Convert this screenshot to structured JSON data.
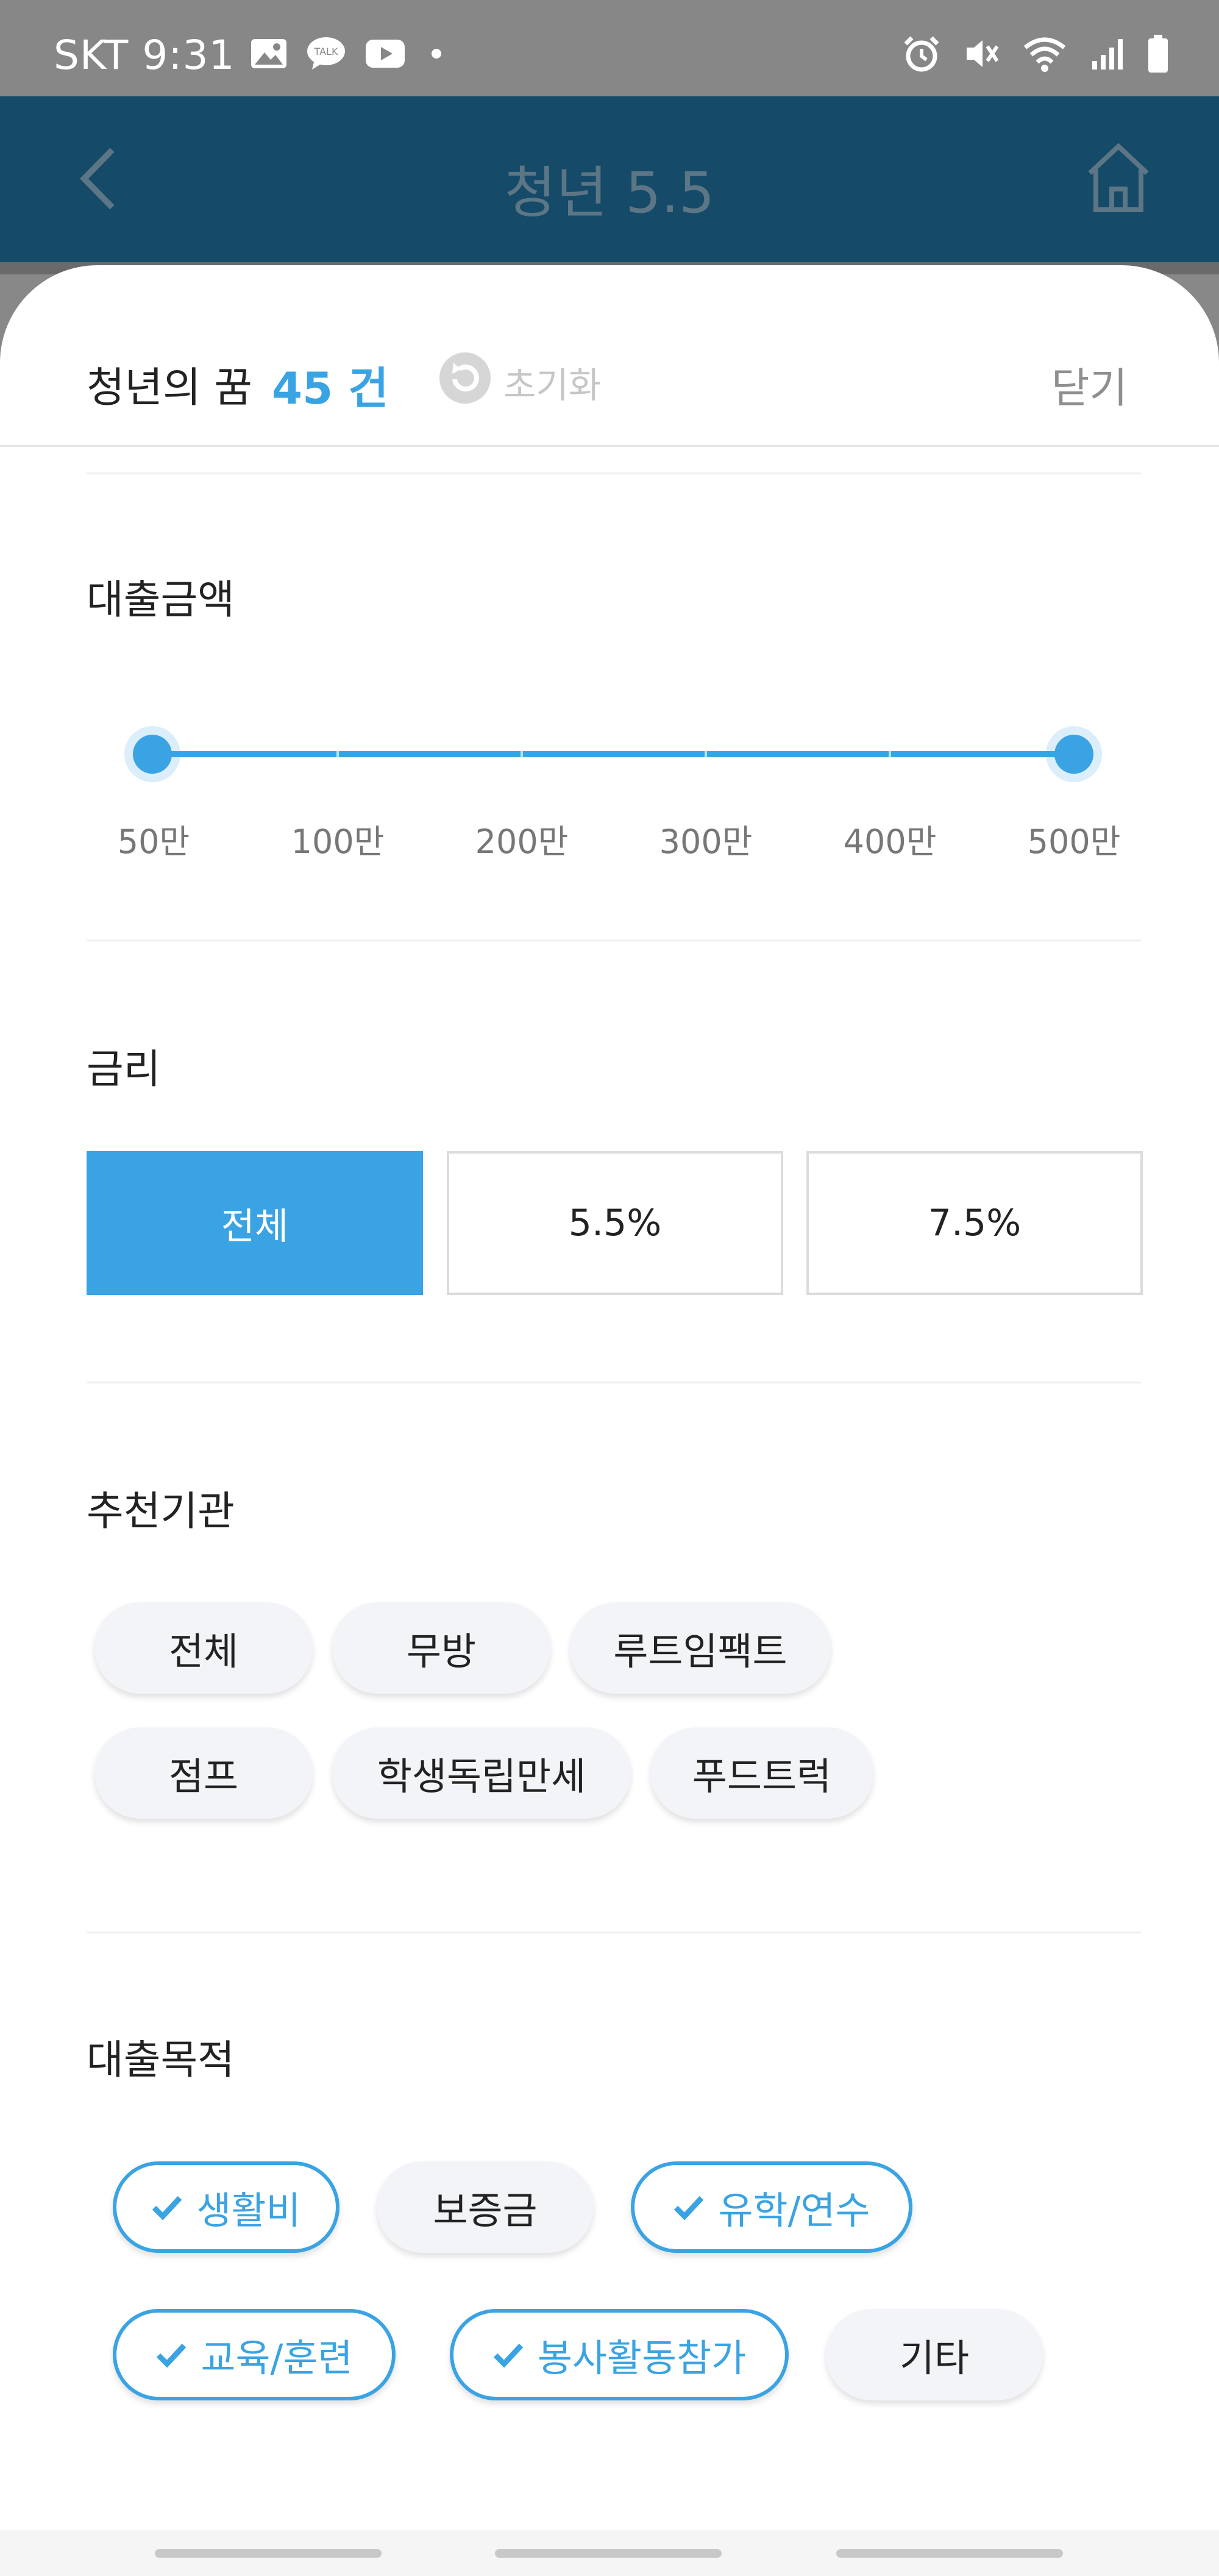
{
  "status_bar": {
    "carrier_time": "SKT 9:31",
    "left_icons": [
      "image-icon",
      "kakaotalk-icon",
      "youtube-icon",
      "dot-icon"
    ],
    "right_icons": [
      "alarm-icon",
      "vibrate-mute-icon",
      "wifi-icon",
      "signal-icon",
      "battery-icon"
    ],
    "talk_text": "TALK"
  },
  "app_bar": {
    "title": "청년 5.5",
    "back_icon": "chevron-left-icon",
    "home_icon": "home-icon"
  },
  "sheet": {
    "title": "청년의 꿈",
    "count": "45 건",
    "reset_label": "초기화",
    "close_label": "닫기"
  },
  "loan_amount": {
    "label": "대출금액",
    "ticks": [
      "50만",
      "100만",
      "200만",
      "300만",
      "400만",
      "500만"
    ],
    "selected_min": "50만",
    "selected_max": "500만"
  },
  "interest": {
    "label": "금리",
    "options": [
      {
        "label": "전체",
        "selected": true
      },
      {
        "label": "5.5%",
        "selected": false
      },
      {
        "label": "7.5%",
        "selected": false
      }
    ]
  },
  "agency": {
    "label": "추천기관",
    "chips": [
      "전체",
      "무방",
      "루트임팩트",
      "점프",
      "학생독립만세",
      "푸드트럭"
    ]
  },
  "purpose": {
    "label": "대출목적",
    "chips": [
      {
        "label": "생활비",
        "checked": true
      },
      {
        "label": "보증금",
        "checked": false
      },
      {
        "label": "유학/연수",
        "checked": true
      },
      {
        "label": "교육/훈련",
        "checked": true
      },
      {
        "label": "봉사활동참가",
        "checked": true
      },
      {
        "label": "기타",
        "checked": false
      }
    ]
  },
  "colors": {
    "accent": "#3aa3e3",
    "app_bar": "#154a68",
    "status_bar": "#878787"
  }
}
